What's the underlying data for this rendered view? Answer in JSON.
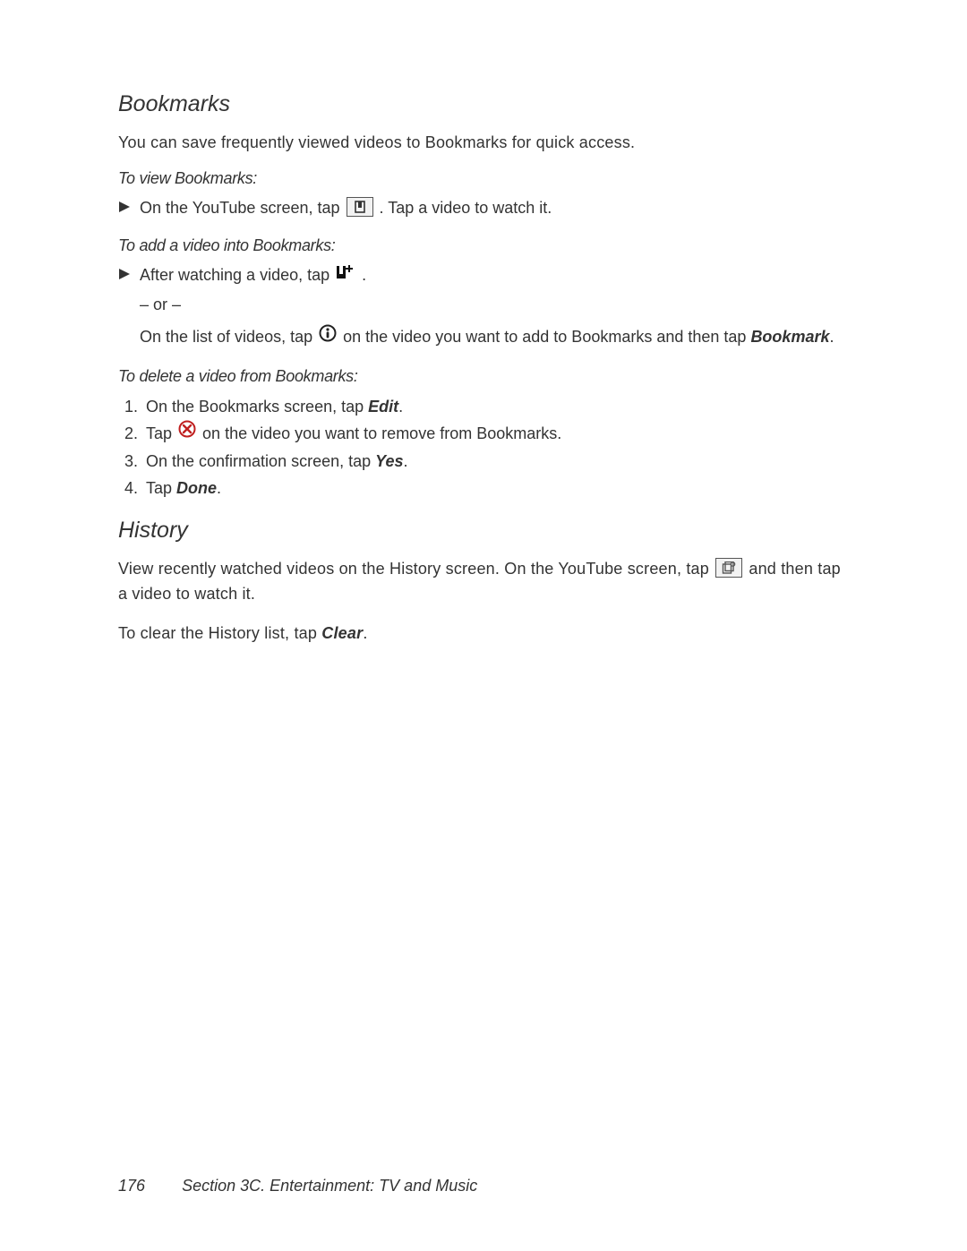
{
  "bookmarks": {
    "heading": "Bookmarks",
    "intro": "You can save frequently viewed videos to Bookmarks for quick access.",
    "view": {
      "subhead": "To view Bookmarks:",
      "pre": "On the YouTube screen, tap ",
      "post": ". Tap a video to watch it."
    },
    "add": {
      "subhead": "To add a video into Bookmarks:",
      "line1_pre": "After watching a video, tap ",
      "line1_post": ".",
      "or": "– or –",
      "line2_pre": "On the list of videos, tap ",
      "line2_mid": " on the video you want to add to Bookmarks and then tap ",
      "line2_em": "Bookmark",
      "line2_post": "."
    },
    "del": {
      "subhead": "To delete a video from Bookmarks:",
      "s1_pre": "On the Bookmarks screen, tap ",
      "s1_em": "Edit",
      "s1_post": ".",
      "s2_pre": "Tap ",
      "s2_post": " on the video you want to remove from Bookmarks.",
      "s3_pre": "On the confirmation screen, tap ",
      "s3_em": "Yes",
      "s3_post": ".",
      "s4_pre": "Tap ",
      "s4_em": "Done",
      "s4_post": "."
    }
  },
  "history": {
    "heading": "History",
    "p1_pre": "View recently watched videos on the History screen. On the YouTube screen, tap ",
    "p1_post": " and then tap a video to watch it.",
    "p2_pre": "To clear the History list, tap ",
    "p2_em": "Clear",
    "p2_post": "."
  },
  "footer": {
    "page": "176",
    "section": "Section 3C. Entertainment: TV and Music"
  }
}
